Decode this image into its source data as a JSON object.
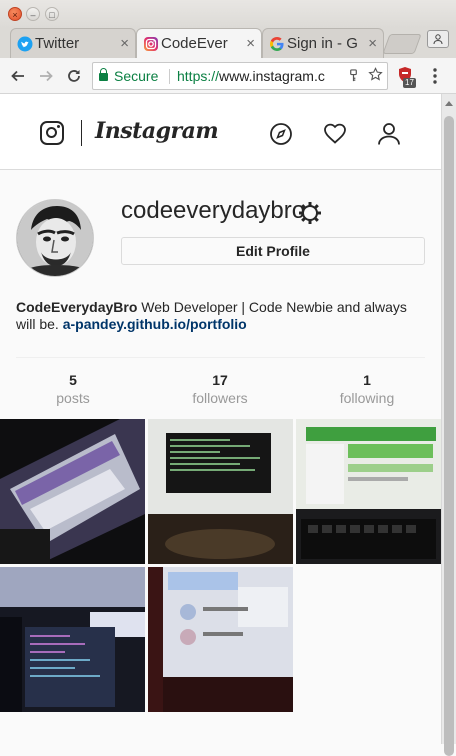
{
  "browser": {
    "tabs": [
      {
        "label": "Twitter",
        "close": "×"
      },
      {
        "label": "CodeEver",
        "close": "×"
      },
      {
        "label": "Sign in - G",
        "close": "×"
      }
    ],
    "window_buttons": {
      "close": "×",
      "minimize": "–",
      "maximize": "□"
    },
    "address": {
      "secure_label": "Secure",
      "scheme": "https://",
      "host": "www.instagram.c"
    },
    "extension_badge": "17"
  },
  "instagram": {
    "wordmark": "Instagram",
    "profile": {
      "username": "codeeverydaybro",
      "edit_button": "Edit Profile",
      "bio_name": "CodeEverydayBro",
      "bio_text": " Web Developer | Code Newbie and always will be. ",
      "bio_link": "a-pandey.github.io/portfolio"
    },
    "stats": [
      {
        "value": "5",
        "label": "posts"
      },
      {
        "value": "17",
        "label": "followers"
      },
      {
        "value": "1",
        "label": "following"
      }
    ]
  },
  "colors": {
    "secure_green": "#0b8043",
    "link_blue": "#003569",
    "text": "#262626",
    "muted": "#999999"
  }
}
